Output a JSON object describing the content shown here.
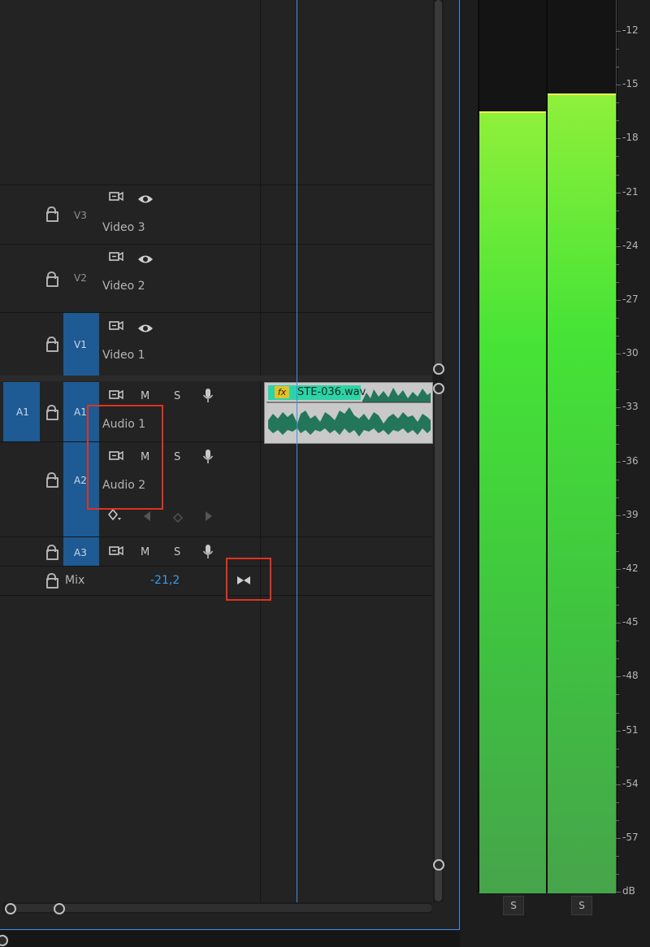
{
  "tracks": {
    "video": [
      {
        "id": "V3",
        "name": "Video 3"
      },
      {
        "id": "V2",
        "name": "Video 2"
      },
      {
        "id": "V1",
        "name": "Video 1"
      }
    ],
    "audio": [
      {
        "source": "A1",
        "id": "A1",
        "name": "Audio 1",
        "mute": "M",
        "solo": "S"
      },
      {
        "id": "A2",
        "name": "Audio 2",
        "mute": "M",
        "solo": "S"
      },
      {
        "id": "A3",
        "mute": "M",
        "solo": "S"
      }
    ],
    "mix": {
      "label": "Mix",
      "value": "-21,2"
    }
  },
  "clip": {
    "fx": "fx",
    "name": "STE-036.wav"
  },
  "meter": {
    "ticks": [
      "-12",
      "-15",
      "-18",
      "-21",
      "-24",
      "-27",
      "-30",
      "-33",
      "-36",
      "-39",
      "-42",
      "-45",
      "-48",
      "-51",
      "-54",
      "-57",
      "dB"
    ],
    "solo_left": "S",
    "solo_right": "S",
    "peak_left_db": -16.5,
    "peak_right_db": -15.5
  },
  "colors": {
    "accent": "#1e5a93",
    "playhead": "#3d8fe6",
    "clip": "#2bd3a6",
    "highlight": "#e0321f",
    "mix_value": "#3d9be9"
  }
}
